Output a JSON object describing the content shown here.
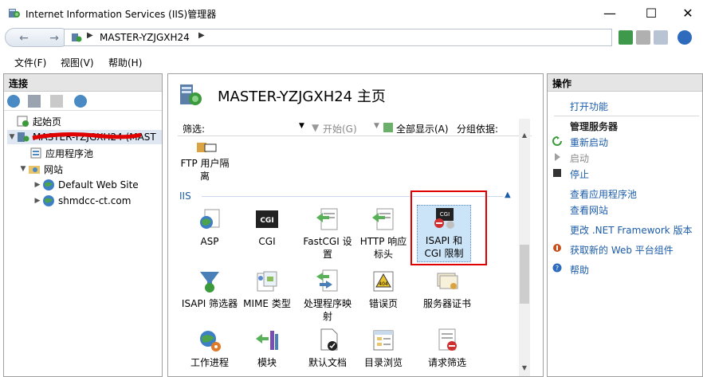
{
  "window": {
    "title": "Internet Information Services (IIS)管理器"
  },
  "address": {
    "path": "MASTER-YZJGXH24"
  },
  "menu": [
    "文件(F)",
    "视图(V)",
    "帮助(H)"
  ],
  "connections": {
    "header": "连接",
    "tree": [
      {
        "label": "起始页",
        "level": 0
      },
      {
        "label": "MASTER-YZJGXH24 (MAST",
        "level": 0
      },
      {
        "label": "应用程序池",
        "level": 1
      },
      {
        "label": "网站",
        "level": 1
      },
      {
        "label": "Default Web Site",
        "level": 2
      },
      {
        "label": "shmdcc-ct.com",
        "level": 2
      }
    ]
  },
  "center": {
    "title": "MASTER-YZJGXH24 主页",
    "filter_label": "筛选:",
    "start_label": "开始(G)",
    "show_all_label": "全部显示(A)",
    "group_by_label": "分组依据:",
    "section_iis": "IIS",
    "features": [
      {
        "label": "FTP 用户隔离"
      },
      {
        "label": "ASP"
      },
      {
        "label": "CGI"
      },
      {
        "label": "FastCGI 设置"
      },
      {
        "label": "HTTP 响应标头"
      },
      {
        "label": "ISAPI 和 CGI 限制"
      },
      {
        "label": "ISAPI 筛选器"
      },
      {
        "label": "MIME 类型"
      },
      {
        "label": "处理程序映射"
      },
      {
        "label": "错误页"
      },
      {
        "label": "服务器证书"
      },
      {
        "label": "工作进程"
      },
      {
        "label": "模块"
      },
      {
        "label": "默认文档"
      },
      {
        "label": "目录浏览"
      },
      {
        "label": "请求筛选"
      }
    ]
  },
  "actions": {
    "header": "操作",
    "open_feature": "打开功能",
    "manage_server": "管理服务器",
    "restart": "重新启动",
    "start": "启动",
    "stop": "停止",
    "view_app_pools": "查看应用程序池",
    "view_sites": "查看网站",
    "change_net": "更改 .NET Framework 版本",
    "get_web_platform": "获取新的 Web 平台组件",
    "help": "帮助"
  },
  "colors": {
    "link": "#1c5ca8",
    "highlight": "#e00000",
    "selected_bg": "#cce4f7"
  }
}
